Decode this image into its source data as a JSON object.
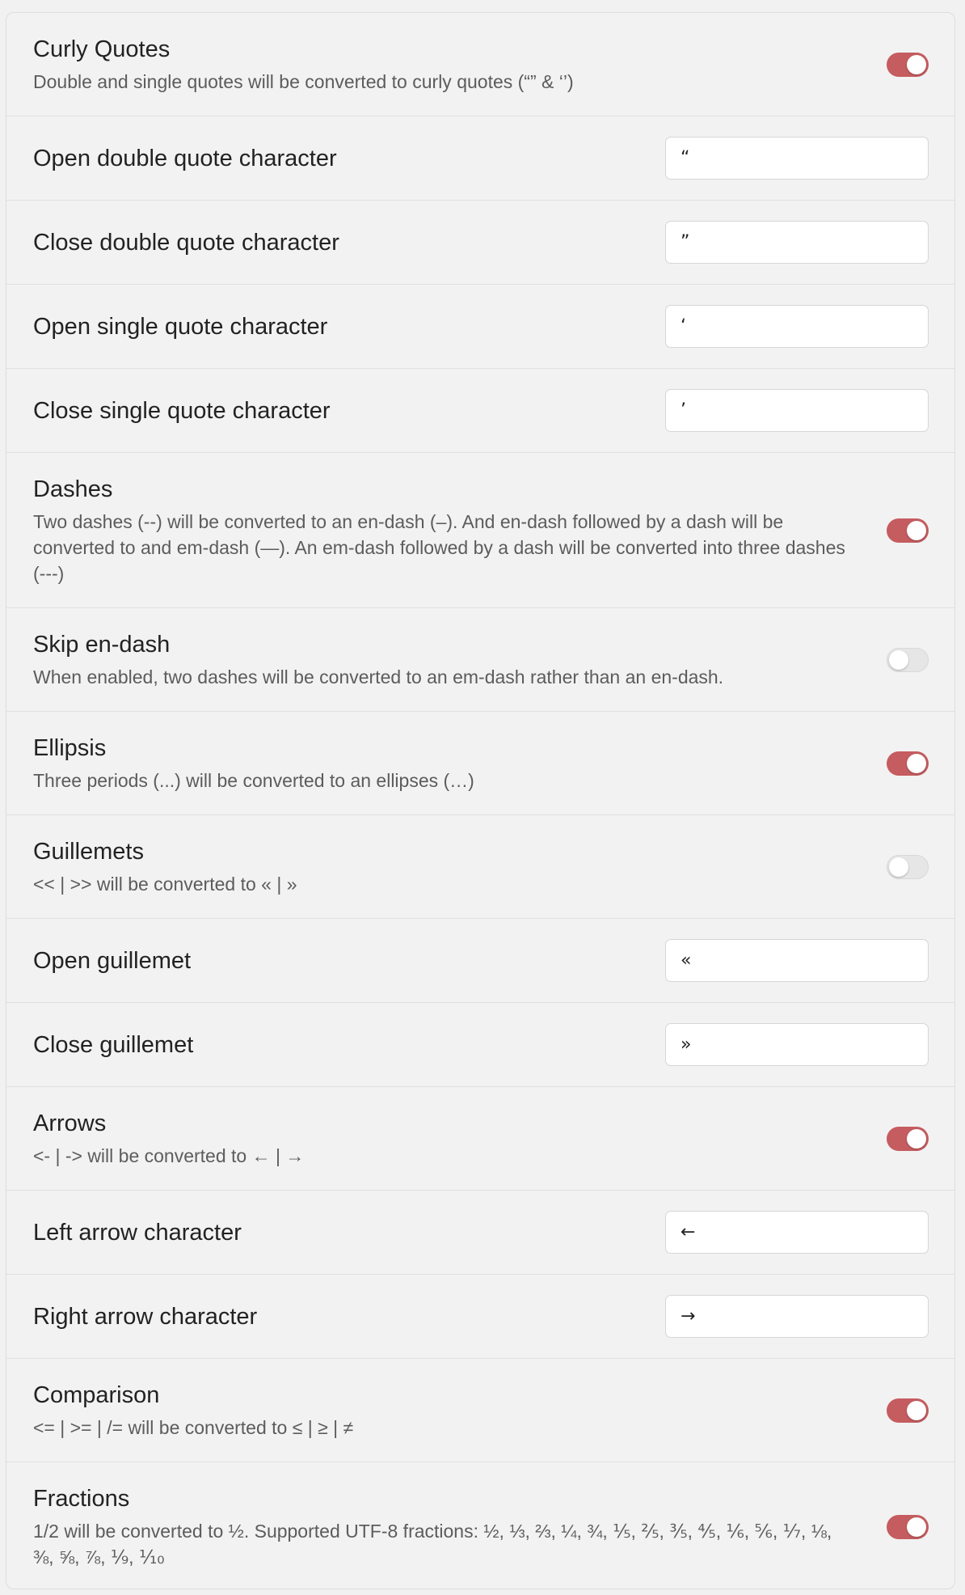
{
  "settings": [
    {
      "kind": "toggle",
      "title": "Curly Quotes",
      "desc": "Double and single quotes will be converted to curly quotes (“” & ‘’)",
      "on": true
    },
    {
      "kind": "input",
      "title": "Open double quote character",
      "value": "“"
    },
    {
      "kind": "input",
      "title": "Close double quote character",
      "value": "”"
    },
    {
      "kind": "input",
      "title": "Open single quote character",
      "value": "‘"
    },
    {
      "kind": "input",
      "title": "Close single quote character",
      "value": "’"
    },
    {
      "kind": "toggle",
      "title": "Dashes",
      "desc": "Two dashes (--) will be converted to an en-dash (–). And en-dash followed by a dash will be converted to and em-dash (—). An em-dash followed by a dash will be converted into three dashes (---)",
      "on": true
    },
    {
      "kind": "toggle",
      "title": "Skip en-dash",
      "desc": "When enabled, two dashes will be converted to an em-dash rather than an en-dash.",
      "on": false
    },
    {
      "kind": "toggle",
      "title": "Ellipsis",
      "desc": "Three periods (...) will be converted to an ellipses (…)",
      "on": true
    },
    {
      "kind": "toggle",
      "title": "Guillemets",
      "desc": "<< | >> will be converted to « | »",
      "on": false
    },
    {
      "kind": "input",
      "title": "Open guillemet",
      "value": "«"
    },
    {
      "kind": "input",
      "title": "Close guillemet",
      "value": "»"
    },
    {
      "kind": "toggle",
      "title": "Arrows",
      "desc": "<- | -> will be converted to ← | →",
      "on": true
    },
    {
      "kind": "input",
      "title": "Left arrow character",
      "value": "←"
    },
    {
      "kind": "input",
      "title": "Right arrow character",
      "value": "→"
    },
    {
      "kind": "toggle",
      "title": "Comparison",
      "desc": "<= | >= | /= will be converted to ≤ | ≥ | ≠",
      "on": true
    },
    {
      "kind": "toggle",
      "title": "Fractions",
      "desc": "1/2 will be converted to ½. Supported UTF-8 fractions: ½, ⅓, ⅔, ¼, ¾, ⅕, ⅖, ⅗, ⅘, ⅙, ⅚, ⅐, ⅛, ⅜, ⅝, ⅞, ⅑, ⅒",
      "on": true
    }
  ],
  "colors": {
    "accent": "#c55c5f",
    "background": "#f2f2f2",
    "border": "#e0e0e0"
  }
}
